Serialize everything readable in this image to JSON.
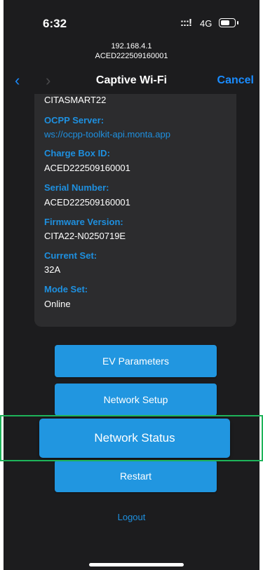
{
  "status_bar": {
    "time": "6:32",
    "signal": ":::!",
    "network": "4G"
  },
  "browser": {
    "url_ip": "192.168.4.1",
    "url_id": "ACED222509160001"
  },
  "nav": {
    "back_icon": "chevron-left-icon",
    "forward_icon": "chevron-right-icon",
    "title": "Captive Wi-Fi",
    "cancel": "Cancel"
  },
  "info": {
    "name_value": "CITASMART22",
    "ocpp_label": "OCPP Server:",
    "ocpp_value": "ws://ocpp-toolkit-api.monta.app",
    "charge_box_label": "Charge Box ID:",
    "charge_box_value": "ACED222509160001",
    "serial_label": "Serial Number:",
    "serial_value": "ACED222509160001",
    "firmware_label": "Firmware Version:",
    "firmware_value": "CITA22-N0250719E",
    "current_label": "Current Set:",
    "current_value": "32A",
    "mode_label": "Mode Set:",
    "mode_value": "Online"
  },
  "buttons": {
    "ev_parameters": "EV Parameters",
    "network_setup": "Network Setup",
    "network_status": "Network Status",
    "restart": "Restart",
    "logout": "Logout"
  },
  "colors": {
    "accent": "#2196e0",
    "link": "#1e90e0",
    "highlight": "#1eb45a",
    "background": "#1c1c1e",
    "card": "#2c2c2e"
  }
}
